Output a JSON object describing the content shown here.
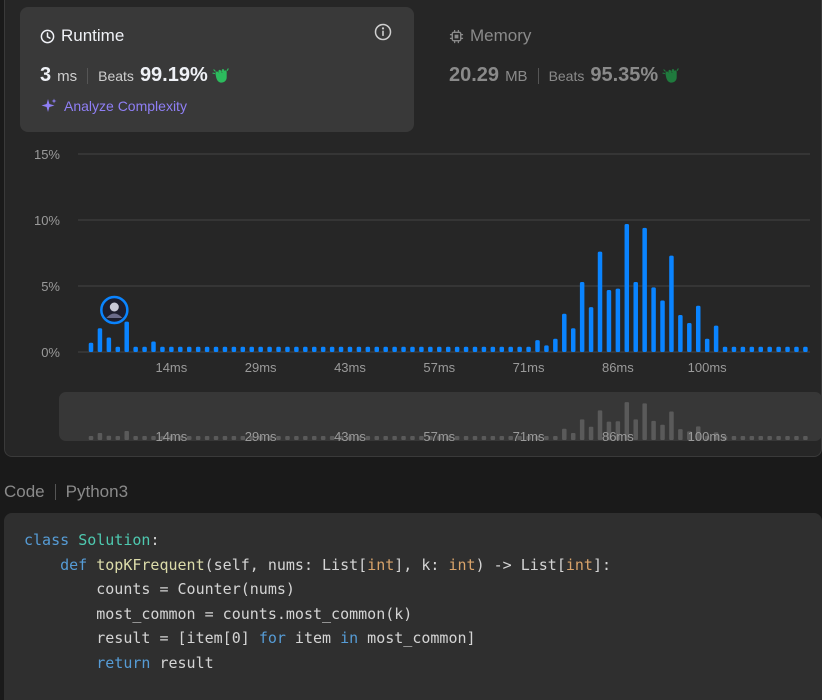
{
  "runtime": {
    "title": "Runtime",
    "value": "3",
    "unit": "ms",
    "beats_label": "Beats",
    "beats_value": "99.19%",
    "analyze_label": "Analyze Complexity"
  },
  "memory": {
    "title": "Memory",
    "value": "20.29",
    "unit": "MB",
    "beats_label": "Beats",
    "beats_value": "95.35%"
  },
  "colors": {
    "accent_blue": "#0a84ff",
    "clap_green": "#2cbb5d",
    "analyze_purple": "#8f7ff5",
    "muted_bar": "#5a5a5a"
  },
  "icons": {
    "runtime": "clock-icon",
    "memory": "chip-icon",
    "info": "info-icon",
    "analyze": "sparkle-icon",
    "beats": "clap-icon",
    "user": "avatar"
  },
  "chart_data": {
    "type": "bar",
    "yticks": [
      "15%",
      "10%",
      "5%",
      "0%"
    ],
    "ylim": [
      0,
      15
    ],
    "xticks": [
      "14ms",
      "29ms",
      "43ms",
      "57ms",
      "71ms",
      "86ms",
      "100ms"
    ],
    "xtick_bins": [
      9,
      19,
      29,
      39,
      49,
      59,
      69
    ],
    "values": [
      0.7,
      1.8,
      1.1,
      0.4,
      2.3,
      0.4,
      0.4,
      0.8,
      0.4,
      0.4,
      0.4,
      0.4,
      0.4,
      0.4,
      0.4,
      0.4,
      0.4,
      0.4,
      0.4,
      0.4,
      0.4,
      0.4,
      0.4,
      0.4,
      0.4,
      0.4,
      0.4,
      0.4,
      0.4,
      0.4,
      0.4,
      0.4,
      0.4,
      0.4,
      0.4,
      0.4,
      0.4,
      0.4,
      0.4,
      0.4,
      0.4,
      0.4,
      0.4,
      0.4,
      0.4,
      0.4,
      0.4,
      0.4,
      0.4,
      0.4,
      0.9,
      0.5,
      1.0,
      2.9,
      1.8,
      5.3,
      3.4,
      7.6,
      4.7,
      4.8,
      9.7,
      5.3,
      9.4,
      4.9,
      3.9,
      7.3,
      2.8,
      2.2,
      3.5,
      1.0,
      2.0,
      0.4,
      0.4,
      0.4,
      0.4,
      0.4,
      0.4,
      0.4,
      0.4,
      0.4,
      0.4
    ],
    "highlight_index": 3,
    "grid": true
  },
  "code": {
    "label": "Code",
    "language": "Python3"
  }
}
